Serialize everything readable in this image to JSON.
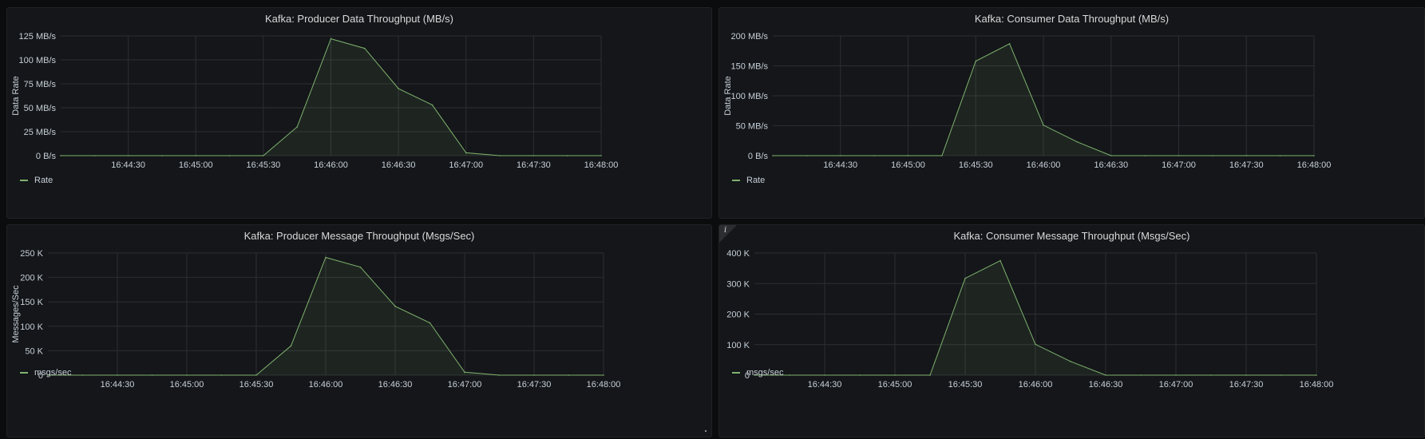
{
  "theme": {
    "series_color": "#7eb26d",
    "fill_color": "rgba(126,178,109,0.10)",
    "grid_color": "#2c2e33",
    "panel_bg": "#141619",
    "page_bg": "#0b0c0e"
  },
  "chart_data": [
    {
      "type": "area",
      "title": "Kafka: Producer Data Throughput (MB/s)",
      "ylabel": "Data Rate",
      "xlabel": "",
      "x_ticks": [
        "16:44:30",
        "16:45:00",
        "16:45:30",
        "16:46:00",
        "16:46:30",
        "16:47:00",
        "16:47:30",
        "16:48:00"
      ],
      "x_range": [
        "16:44:00",
        "16:48:00"
      ],
      "y_ticks": [
        "0 B/s",
        "25 MB/s",
        "50 MB/s",
        "75 MB/s",
        "100 MB/s",
        "125 MB/s"
      ],
      "y_unit": "MB/s",
      "ylim": [
        0,
        125
      ],
      "grid": true,
      "legend_placement": "bottom-left",
      "series": [
        {
          "name": "Rate",
          "x": [
            "16:44:00",
            "16:44:15",
            "16:44:30",
            "16:44:45",
            "16:45:00",
            "16:45:15",
            "16:45:30",
            "16:45:45",
            "16:46:00",
            "16:46:15",
            "16:46:30",
            "16:46:45",
            "16:47:00",
            "16:47:15",
            "16:47:30",
            "16:47:45",
            "16:48:00"
          ],
          "values": [
            0,
            0,
            0,
            0,
            0,
            0,
            0,
            30,
            122,
            112,
            70,
            53,
            3,
            0,
            0,
            0,
            0
          ]
        }
      ]
    },
    {
      "type": "area",
      "title": "Kafka: Consumer Data Throughput (MB/s)",
      "ylabel": "Data Rate",
      "xlabel": "",
      "x_ticks": [
        "16:44:30",
        "16:45:00",
        "16:45:30",
        "16:46:00",
        "16:46:30",
        "16:47:00",
        "16:47:30",
        "16:48:00"
      ],
      "x_range": [
        "16:44:00",
        "16:48:00"
      ],
      "y_ticks": [
        "0 B/s",
        "50 MB/s",
        "100 MB/s",
        "150 MB/s",
        "200 MB/s"
      ],
      "y_unit": "MB/s",
      "ylim": [
        0,
        200
      ],
      "grid": true,
      "legend_placement": "bottom-left",
      "series": [
        {
          "name": "Rate",
          "x": [
            "16:44:00",
            "16:44:15",
            "16:44:30",
            "16:44:45",
            "16:45:00",
            "16:45:15",
            "16:45:30",
            "16:45:45",
            "16:46:00",
            "16:46:15",
            "16:46:30",
            "16:46:45",
            "16:47:00",
            "16:47:15",
            "16:47:30",
            "16:47:45",
            "16:48:00"
          ],
          "values": [
            0,
            0,
            0,
            0,
            0,
            0,
            158,
            187,
            51,
            23,
            0,
            0,
            0,
            0,
            0,
            0,
            0
          ]
        }
      ]
    },
    {
      "type": "area",
      "title": "Kafka: Producer Message Throughput (Msgs/Sec)",
      "ylabel": "Messages/Sec",
      "xlabel": "",
      "x_ticks": [
        "16:44:30",
        "16:45:00",
        "16:45:30",
        "16:46:00",
        "16:46:30",
        "16:47:00",
        "16:47:30",
        "16:48:00"
      ],
      "x_range": [
        "16:44:00",
        "16:48:00"
      ],
      "y_ticks": [
        "0",
        "50 K",
        "100 K",
        "150 K",
        "200 K",
        "250 K"
      ],
      "y_unit": "K",
      "ylim": [
        0,
        250
      ],
      "grid": true,
      "legend_placement": "bottom-left",
      "series": [
        {
          "name": "msgs/sec",
          "x": [
            "16:44:00",
            "16:44:15",
            "16:44:30",
            "16:44:45",
            "16:45:00",
            "16:45:15",
            "16:45:30",
            "16:45:45",
            "16:46:00",
            "16:46:15",
            "16:46:30",
            "16:46:45",
            "16:47:00",
            "16:47:15",
            "16:47:30",
            "16:47:45",
            "16:48:00"
          ],
          "values": [
            0,
            0,
            0,
            0,
            0,
            0,
            0,
            60,
            241,
            221,
            141,
            107,
            6,
            0,
            0,
            0,
            0
          ]
        }
      ]
    },
    {
      "type": "area",
      "title": "Kafka: Consumer Message Throughput (Msgs/Sec)",
      "ylabel": "",
      "xlabel": "",
      "x_ticks": [
        "16:44:30",
        "16:45:00",
        "16:45:30",
        "16:46:00",
        "16:46:30",
        "16:47:00",
        "16:47:30",
        "16:48:00"
      ],
      "x_range": [
        "16:44:00",
        "16:48:00"
      ],
      "y_ticks": [
        "0",
        "100 K",
        "200 K",
        "300 K",
        "400 K"
      ],
      "y_unit": "K",
      "ylim": [
        0,
        400
      ],
      "grid": true,
      "legend_placement": "bottom-left",
      "info_icon": "i",
      "series": [
        {
          "name": "msgs/sec",
          "x": [
            "16:44:00",
            "16:44:15",
            "16:44:30",
            "16:44:45",
            "16:45:00",
            "16:45:15",
            "16:45:30",
            "16:45:45",
            "16:46:00",
            "16:46:15",
            "16:46:30",
            "16:46:45",
            "16:47:00",
            "16:47:15",
            "16:47:30",
            "16:47:45",
            "16:48:00"
          ],
          "values": [
            0,
            0,
            0,
            0,
            0,
            0,
            317,
            375,
            101,
            45,
            0,
            0,
            0,
            0,
            0,
            0,
            0
          ]
        }
      ]
    }
  ]
}
